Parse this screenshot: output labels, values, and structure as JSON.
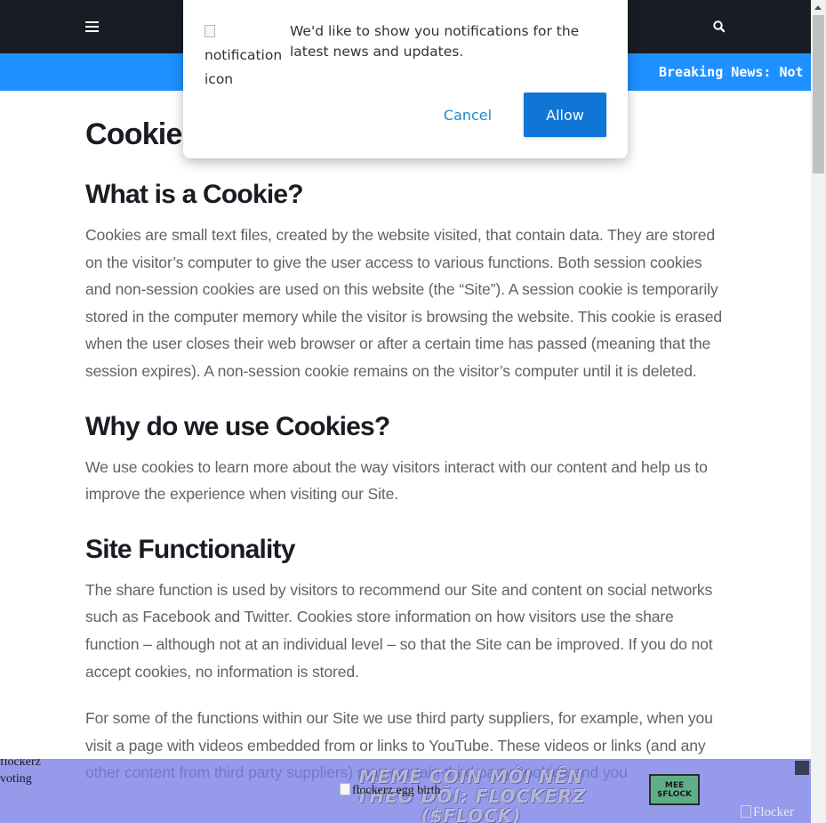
{
  "nav": {
    "menu_icon": "hamburger-menu-icon",
    "search_icon": "search-icon",
    "breaking_news": "Breaking News: Not"
  },
  "colors": {
    "navbar": "#181c24",
    "breaking_bar": "#1e90ff",
    "allow_button": "#0f76d6",
    "heading": "#191c22",
    "body_text": "#5f6369"
  },
  "notification": {
    "icon_alt": "notification icon",
    "message": "We'd like to show you notifications for the latest news and updates.",
    "cancel_label": "Cancel",
    "allow_label": "Allow"
  },
  "article": {
    "title": "Cookie Policy",
    "sections": [
      {
        "heading": "What is a Cookie?",
        "body": "Cookies are small text files, created by the website visited, that contain data. They are stored on the visitor’s computer to give the user access to various functions. Both session cookies and non-session cookies are used on this website (the “Site”). A session cookie is temporarily stored in the computer memory while the visitor is browsing the website. This cookie is erased when the user closes their web browser or after a certain time has passed (meaning that the session expires). A non-session cookie remains on the visitor’s computer until it is deleted."
      },
      {
        "heading": "Why do we use Cookies?",
        "body": "We use cookies to learn more about the way visitors interact with our content and help us to improve the experience when visiting our Site."
      },
      {
        "heading": "Site Functionality",
        "body": "The share function is used by visitors to recommend our Site and content on social networks such as Facebook and Twitter. Cookies store information on how visitors use the share function – although not at an individual level – so that the Site can be improved. If you do not accept cookies, no information is stored.",
        "body2": "For some of the functions within our Site we use third party suppliers, for example, when you visit a page with videos embedded from or links to YouTube. These videos or links (and any other content from third party suppliers) may contain third party cookies and you"
      }
    ]
  },
  "ad_banner": {
    "left_image_alt": "flockerz voting",
    "headline": "MEME COIN MỚI NÊN THEO DÕI: FLOCKERZ ($FLOCK)",
    "center_image_alt": "flockerz egg birth",
    "logo_text_top": "MEE",
    "logo_text_bottom": "$FLOCK",
    "close_icon": "close-icon",
    "right_image_alt": "Flocker"
  }
}
